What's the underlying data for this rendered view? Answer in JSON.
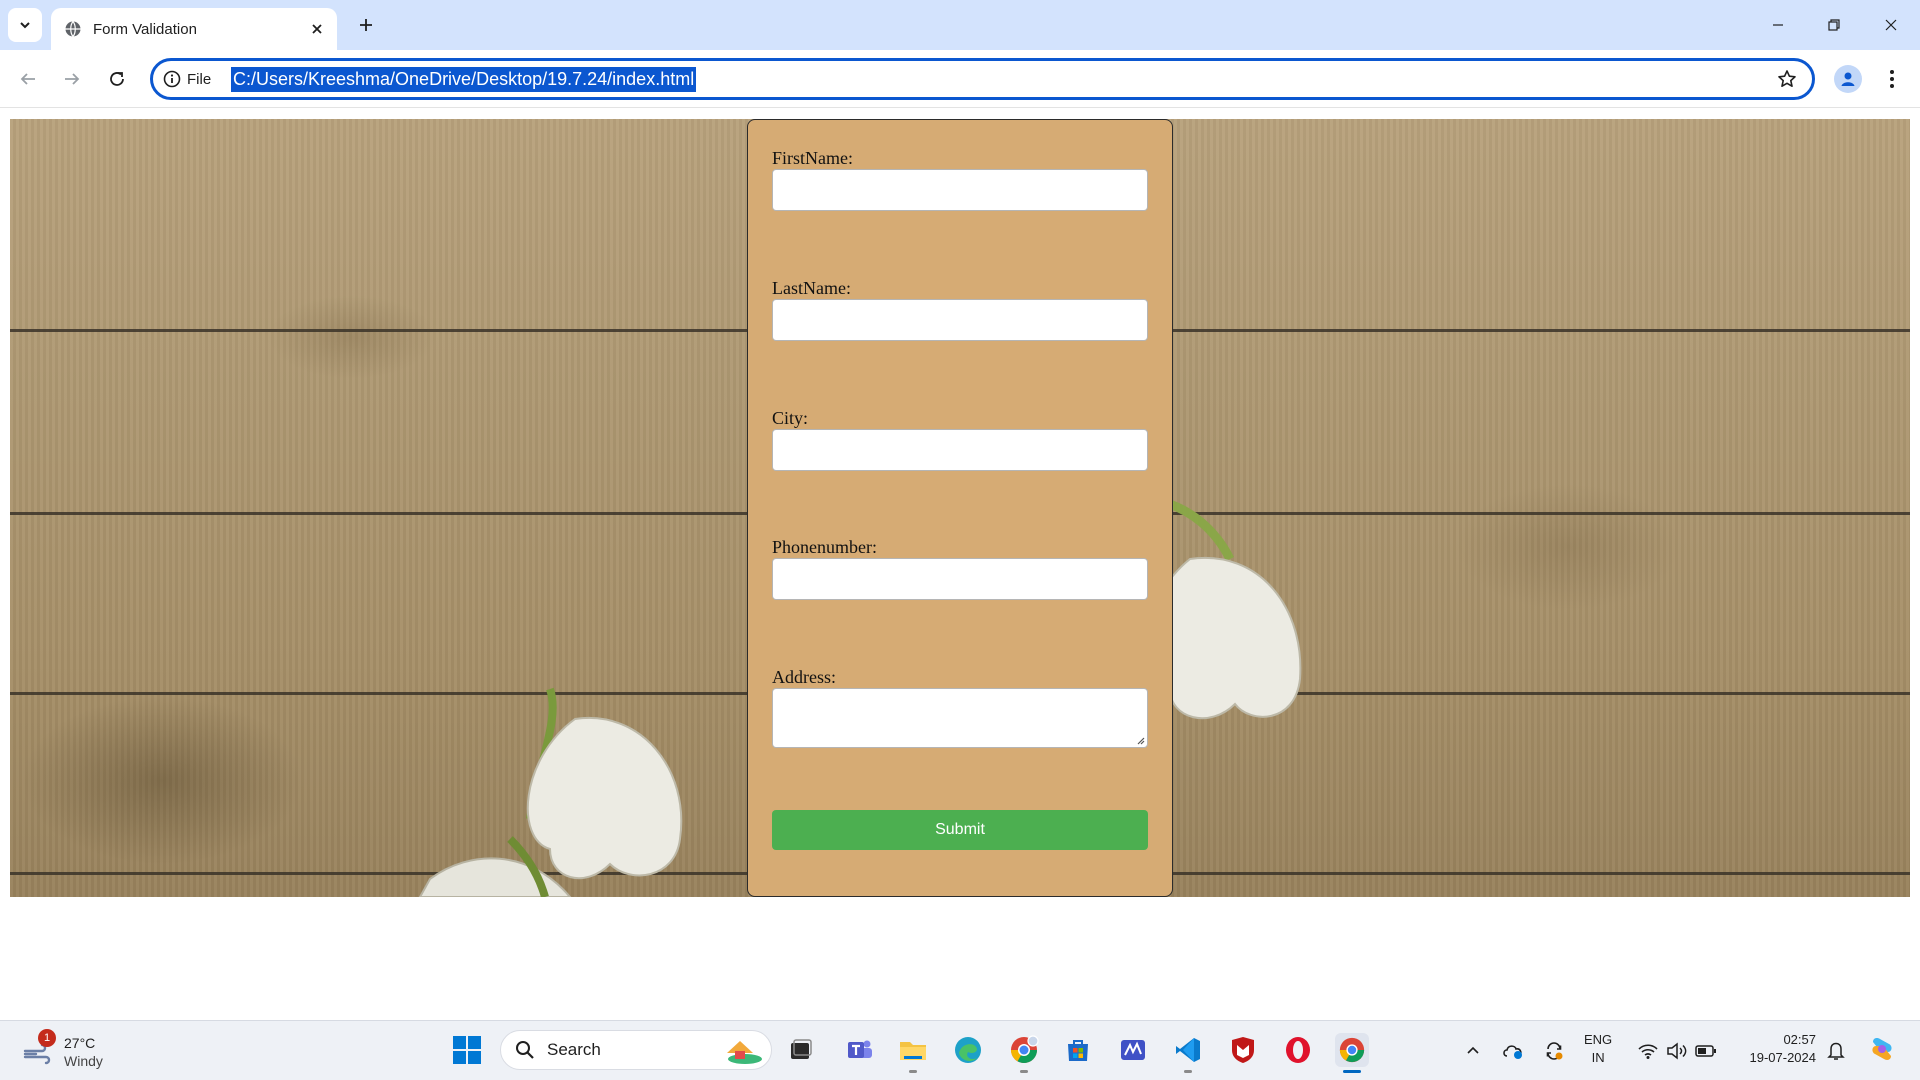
{
  "browser": {
    "tab_title": "Form Validation",
    "url_chip_label": "File",
    "url": "C:/Users/Kreeshma/OneDrive/Desktop/19.7.24/index.html"
  },
  "form": {
    "fields": [
      {
        "label": "FirstName:",
        "value": ""
      },
      {
        "label": "LastName:",
        "value": ""
      },
      {
        "label": "City:",
        "value": ""
      },
      {
        "label": "Phonenumber:",
        "value": ""
      },
      {
        "label": "Address:",
        "value": ""
      }
    ],
    "submit_label": "Submit",
    "card_color": "#d6ab74",
    "submit_color": "#4caf50"
  },
  "taskbar": {
    "weather_badge": "1",
    "weather_temp": "27°C",
    "weather_desc": "Windy",
    "search_label": "Search",
    "language_top": "ENG",
    "language_bottom": "IN",
    "time": "02:57",
    "date": "19-07-2024"
  },
  "colors": {
    "accent": "#0b57d0",
    "tab_strip": "#d3e3fd"
  }
}
